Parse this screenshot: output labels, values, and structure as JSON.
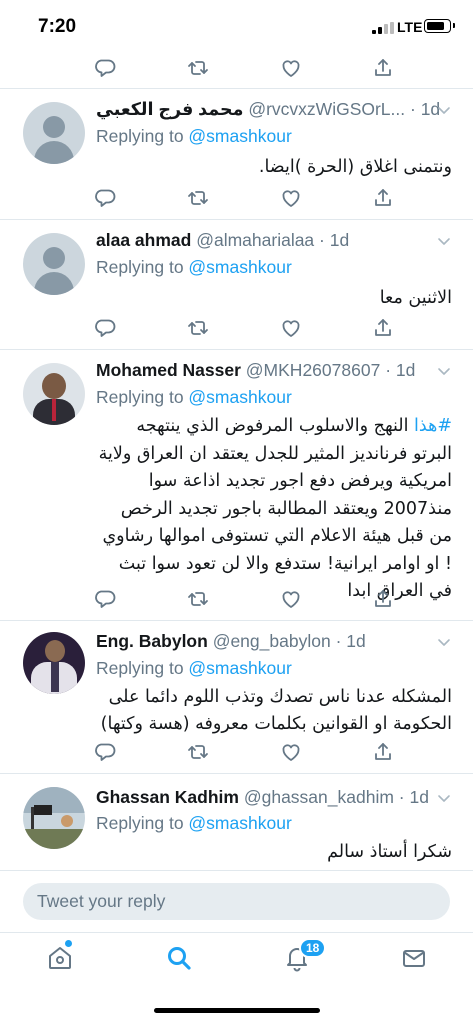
{
  "status_bar": {
    "time": "7:20",
    "network": "LTE"
  },
  "tweets": [
    {
      "name": "محمد فرج الكعبي",
      "handle": "@rvcvxzWiGSOrL...",
      "time": "· 1d",
      "replying_prefix": "Replying to ",
      "replying_to": "@smashkour",
      "text": "ونتمنى اغلاق (الحرة )ايضا."
    },
    {
      "name": "alaa ahmad",
      "handle": "@almaharialaa",
      "time": "· 1d",
      "replying_prefix": "Replying to ",
      "replying_to": "@smashkour",
      "text": "الاثنين معا"
    },
    {
      "name": "Mohamed Nasser",
      "handle": "@MKH26078607",
      "time": "· 1d",
      "replying_prefix": "Replying to ",
      "replying_to": "@smashkour",
      "hashtag": "#هذا",
      "text": " النهج والاسلوب المرفوض الذي ينتهجه البرتو فرنانديز المثير للجدل يعتقد ان العراق ولاية امريكية ويرفض دفع اجور تجديد اذاعة سوا منذ2007 ويعتقد المطالبة باجور تجديد الرخص من قبل هيئة الاعلام التي تستوفى اموالها رشاوي ! او اوامر ايرانية! ستدفع والا لن تعود سوا تبث في العراق ابدا"
    },
    {
      "name": "Eng. Babylon",
      "handle": "@eng_babylon",
      "time": "· 1d",
      "replying_prefix": "Replying to ",
      "replying_to": "@smashkour",
      "text": "المشكله عدنا ناس تصدك وتذب اللوم دائما على الحكومة او القوانين بكلمات معروفه (هسة وكتها)"
    },
    {
      "name": "Ghassan Kadhim",
      "handle": "@ghassan_kadhim",
      "time": "· 1d",
      "replying_prefix": "Replying to ",
      "replying_to": "@smashkour",
      "text": "شكرا أستاذ سالم"
    }
  ],
  "reply_bar": {
    "placeholder": "Tweet your reply"
  },
  "tab_bar": {
    "notifications_badge": "18"
  },
  "colors": {
    "accent": "#1da1f2",
    "secondary_text": "#657786",
    "icon": "#657786",
    "divider": "#e1e8ed"
  }
}
